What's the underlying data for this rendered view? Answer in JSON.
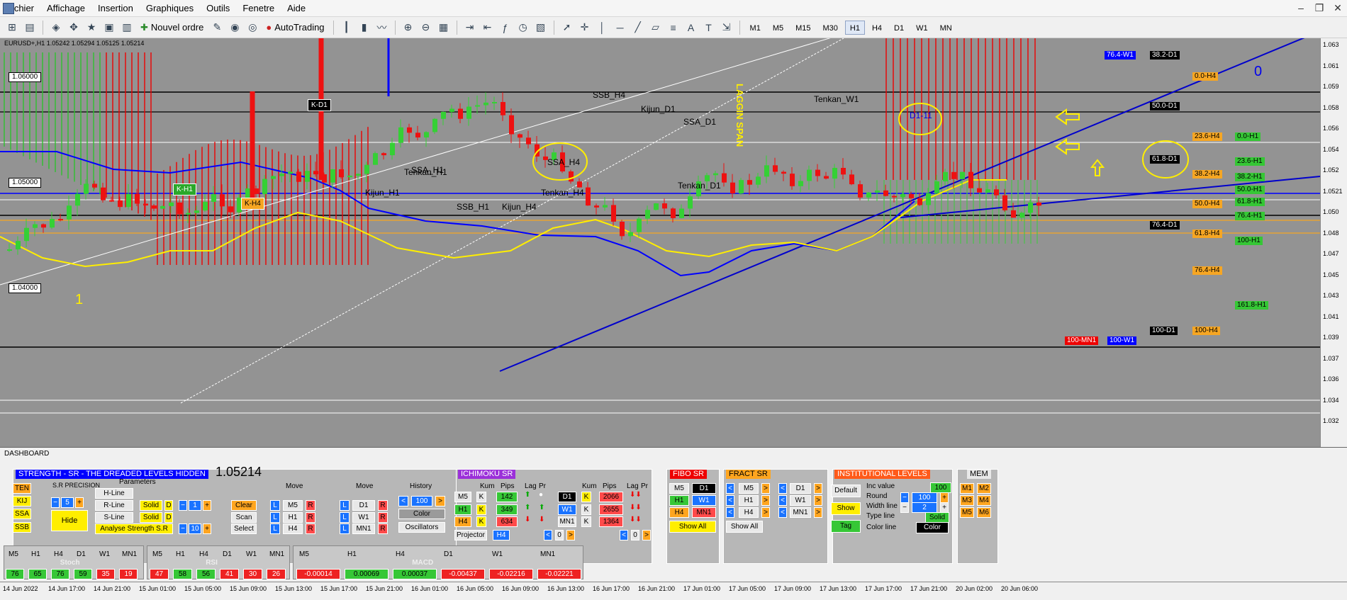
{
  "menu": [
    "Fichier",
    "Affichage",
    "Insertion",
    "Graphiques",
    "Outils",
    "Fenetre",
    "Aide"
  ],
  "toolbar": {
    "new_order": "Nouvel ordre",
    "autotrading": "AutoTrading",
    "timeframes": [
      "M1",
      "M5",
      "M15",
      "M30",
      "H1",
      "H4",
      "D1",
      "W1",
      "MN"
    ],
    "active_tf": "H1"
  },
  "chart": {
    "title": "EURUSD+,H1 1.05242 1.05294 1.05125 1.05214",
    "price_labels": [
      "1.06000",
      "1.05000",
      "1.04000"
    ],
    "annotations": [
      "SSB_H4",
      "Kijun_D1",
      "SSA_D1",
      "Tenkan_W1",
      "SSA_H4",
      "SSA_H1",
      "Tenkan_H1",
      "Kijun_H1",
      "Tenkan_D1",
      "SSB_H1",
      "Kijun_H4",
      "Tenkan_H4",
      "LAGGIN SPAN",
      "D1-11",
      "1",
      "0"
    ],
    "k_boxes": [
      "K-D1",
      "K-H1",
      "K-H4"
    ],
    "levels": [
      {
        "t": "76.4-W1",
        "c": "bl"
      },
      {
        "t": "38.2-D1",
        "c": "bk"
      },
      {
        "t": "0.0-H4",
        "c": "or"
      },
      {
        "t": "50.0-D1",
        "c": "bk"
      },
      {
        "t": "23.6-H4",
        "c": "or"
      },
      {
        "t": "0.0-H1",
        "c": "gr"
      },
      {
        "t": "61.8-D1",
        "c": "bk"
      },
      {
        "t": "23.6-H1",
        "c": "gr"
      },
      {
        "t": "38.2-H4",
        "c": "or"
      },
      {
        "t": "38.2-H1",
        "c": "gr"
      },
      {
        "t": "50.0-H1",
        "c": "gr"
      },
      {
        "t": "50.0-H4",
        "c": "or"
      },
      {
        "t": "61.8-H1",
        "c": "gr"
      },
      {
        "t": "76.4-H1",
        "c": "gr"
      },
      {
        "t": "76.4-D1",
        "c": "bk"
      },
      {
        "t": "61.8-H4",
        "c": "or"
      },
      {
        "t": "100-H1",
        "c": "gr"
      },
      {
        "t": "76.4-H4",
        "c": "or"
      },
      {
        "t": "161.8-H1",
        "c": "gr"
      },
      {
        "t": "100-D1",
        "c": "bk"
      },
      {
        "t": "100-H4",
        "c": "or"
      },
      {
        "t": "100-MN1",
        "c": "rd"
      },
      {
        "t": "100-W1",
        "c": "bl"
      }
    ],
    "yaxis": [
      "1.063",
      "1.061",
      "1.059",
      "1.058",
      "1.056",
      "1.054",
      "1.052",
      "1.0521",
      "1.050",
      "1.048",
      "1.047",
      "1.045",
      "1.043",
      "1.041",
      "1.039",
      "1.037",
      "1.036",
      "1.034",
      "1.032"
    ],
    "xaxis": [
      "14 Jun 2022",
      "14 Jun 17:00",
      "14 Jun 21:00",
      "15 Jun 01:00",
      "15 Jun 05:00",
      "15 Jun 09:00",
      "15 Jun 13:00",
      "15 Jun 17:00",
      "15 Jun 21:00",
      "16 Jun 01:00",
      "16 Jun 05:00",
      "16 Jun 09:00",
      "16 Jun 13:00",
      "16 Jun 17:00",
      "16 Jun 21:00",
      "17 Jun 01:00",
      "17 Jun 05:00",
      "17 Jun 09:00",
      "17 Jun 13:00",
      "17 Jun 17:00",
      "17 Jun 21:00",
      "20 Jun 02:00",
      "20 Jun 06:00"
    ]
  },
  "dashboard": {
    "title": "DASHBOARD",
    "price": "1.05214",
    "strength": {
      "title": "STRENGTH - SR - THE DREADED LEVELS HIDDEN",
      "lines": [
        "TEN",
        "KIJ",
        "SSA",
        "SSB"
      ],
      "precision_label": "S.R PRECISION",
      "precision": "5",
      "hide": "Hide",
      "parameters": "Parameters",
      "hline": "H-Line",
      "rline": "R-Line",
      "sline": "S-Line",
      "solid": "Solid",
      "d": "D",
      "w1": "1",
      "w2": "10",
      "analyse": "Analyse Strength S.R",
      "clear": "Clear",
      "scan": "Scan",
      "select": "Select",
      "move": "Move",
      "history": "History",
      "hist_val": "100",
      "color": "Color",
      "osc": "Oscillators",
      "tf1": [
        "M5",
        "H1",
        "H4"
      ],
      "tf2": [
        "D1",
        "W1",
        "MN1"
      ],
      "L": "L",
      "R": "R"
    },
    "ichimoku": {
      "title": "ICHIMOKU SR",
      "headers": [
        "Kum",
        "Pips",
        "Lag",
        "Pr",
        "Kum",
        "Pips",
        "Lag",
        "Pr"
      ],
      "rows": [
        [
          "M5",
          "K",
          "142"
        ],
        [
          "H1",
          "K",
          "349"
        ],
        [
          "H4",
          "K",
          "634"
        ]
      ],
      "rows2": [
        [
          "D1",
          "K",
          "2066"
        ],
        [
          "W1",
          "K",
          "2655"
        ],
        [
          "MN1",
          "K",
          "1364"
        ]
      ],
      "projector": "Projector",
      "proj_tf": "H4",
      "proj_val": "0"
    },
    "fibo": {
      "title": "FIBO SR",
      "tfs": [
        "M5",
        "D1",
        "H1",
        "W1",
        "H4",
        "MN1"
      ],
      "show_all": "Show All"
    },
    "fract": {
      "title": "FRACT SR",
      "tfs": [
        "M5",
        "D1",
        "H1",
        "W1",
        "H4",
        "MN1"
      ],
      "show_all": "Show All"
    },
    "inst": {
      "title": "INSTITUTIONAL LEVELS",
      "default": "Default",
      "show": "Show",
      "tag": "Tag",
      "inc_label": "Inc value",
      "inc": "100",
      "round_label": "Round",
      "round": "100",
      "width_label": "Width line",
      "width": "2",
      "type_label": "Type line",
      "type": "Solid",
      "color_label": "Color line",
      "color": "Color"
    },
    "mem": {
      "title": "MEM",
      "items": [
        "M1",
        "M2",
        "M3",
        "M4",
        "M5",
        "M6"
      ]
    }
  },
  "osc": {
    "stoch": {
      "label": "Stoch",
      "tfs": [
        "M5",
        "H1",
        "H4",
        "D1",
        "W1",
        "MN1"
      ],
      "vals": [
        "76",
        "65",
        "76",
        "59",
        "35",
        "19"
      ]
    },
    "rsi": {
      "label": "RSI",
      "tfs": [
        "M5",
        "H1",
        "H4",
        "D1",
        "W1",
        "MN1"
      ],
      "vals": [
        "47",
        "58",
        "56",
        "41",
        "30",
        "26"
      ]
    },
    "macd": {
      "label": "MACD",
      "tfs": [
        "M5",
        "H1",
        "H4",
        "D1",
        "W1",
        "MN1"
      ],
      "vals": [
        "-0.00014",
        "0.00069",
        "0.00037",
        "-0.00437",
        "-0.02216",
        "-0.02221"
      ]
    }
  }
}
